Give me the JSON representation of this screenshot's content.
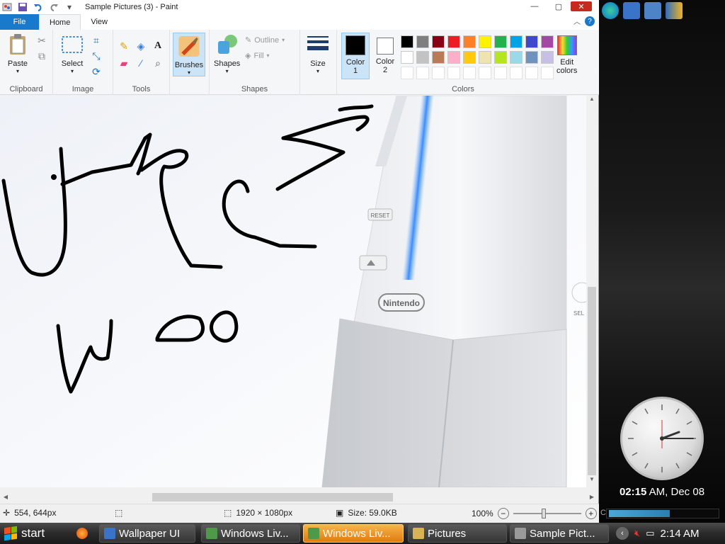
{
  "window": {
    "title": "Sample Pictures (3) - Paint",
    "controls": {
      "minimize": "—",
      "maximize": "▢",
      "close": "✕"
    }
  },
  "tabs": {
    "file": "File",
    "home": "Home",
    "view": "View"
  },
  "ribbon": {
    "clipboard": {
      "label": "Clipboard",
      "paste": "Paste"
    },
    "image": {
      "label": "Image",
      "select": "Select"
    },
    "tools": {
      "label": "Tools"
    },
    "brushes": {
      "label": "Brushes"
    },
    "shapes": {
      "label": "Shapes",
      "shapes_btn": "Shapes",
      "outline": "Outline",
      "fill": "Fill"
    },
    "size": {
      "label": "Size"
    },
    "color1": {
      "line1": "Color",
      "line2": "1"
    },
    "color2": {
      "line1": "Color",
      "line2": "2"
    },
    "colors": {
      "label": "Colors"
    },
    "edit_colors": {
      "line1": "Edit",
      "line2": "colors"
    },
    "palette_row1": [
      "#000000",
      "#7f7f7f",
      "#880015",
      "#ed1c24",
      "#ff7f27",
      "#fff200",
      "#22b14c",
      "#00a2e8",
      "#3f48cc",
      "#a349a4"
    ],
    "palette_row2": [
      "#ffffff",
      "#c3c3c3",
      "#b97a57",
      "#ffaec9",
      "#ffc90e",
      "#efe4b0",
      "#b5e61d",
      "#99d9ea",
      "#7092be",
      "#c8bfe7"
    ]
  },
  "canvas": {
    "reset_label": "RESET",
    "brand_label": "Nintendo",
    "select_label": "SEL"
  },
  "status": {
    "cursor_pos": "554, 644px",
    "dimensions": "1920 × 1080px",
    "size": "Size: 59.0KB",
    "zoom": "100%"
  },
  "sidebar": {
    "clock_time": "02:15",
    "clock_suffix": "AM, Dec 08",
    "cpu_label": "C:",
    "cpu_level": 0.55
  },
  "taskbar": {
    "start": "start",
    "items": [
      "Wallpaper UI",
      "Windows Liv...",
      "Windows Liv...",
      "Pictures",
      "Sample Pict..."
    ],
    "time": "2:14 AM"
  }
}
